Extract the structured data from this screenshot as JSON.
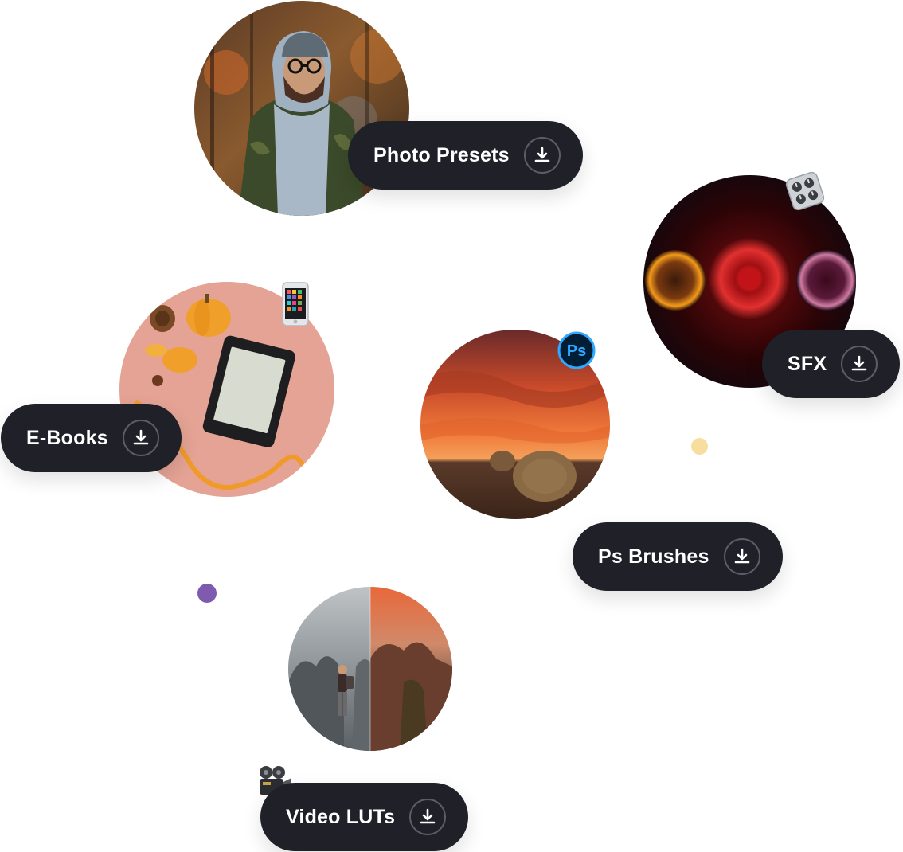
{
  "colors": {
    "pill_background": "#1f2028",
    "pill_text": "#ffffff",
    "dot_purple": "#7f5bb0",
    "dot_yellow": "#f7dd9e",
    "photoshop_badge": "#001e36",
    "photoshop_accent": "#31a8ff"
  },
  "categories": {
    "photo_presets": {
      "label": "Photo Presets",
      "icon": "download-icon"
    },
    "sfx": {
      "label": "SFX",
      "icon": "download-icon",
      "badge": "mixer-knobs-icon"
    },
    "ebooks": {
      "label": "E-Books",
      "icon": "download-icon",
      "badge": "smartphone-icon"
    },
    "ps_brushes": {
      "label": "Ps Brushes",
      "icon": "download-icon",
      "badge": "photoshop-icon",
      "badge_text": "Ps"
    },
    "video_luts": {
      "label": "Video LUTs",
      "icon": "download-icon",
      "badge": "movie-camera-icon"
    }
  }
}
